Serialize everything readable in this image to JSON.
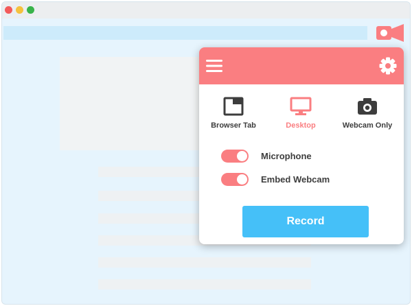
{
  "popup": {
    "modes": [
      {
        "label": "Browser Tab",
        "icon": "browser-tab-icon",
        "active": false
      },
      {
        "label": "Desktop",
        "icon": "desktop-icon",
        "active": true
      },
      {
        "label": "Webcam Only",
        "icon": "camera-icon",
        "active": false
      }
    ],
    "toggles": [
      {
        "label": "Microphone",
        "on": true
      },
      {
        "label": "Embed Webcam",
        "on": true
      }
    ],
    "record_label": "Record"
  },
  "colors": {
    "accent": "#fa7e81",
    "record": "#45c0f8",
    "text": "#3d3d3d",
    "page_bg": "#e6f4fd"
  }
}
